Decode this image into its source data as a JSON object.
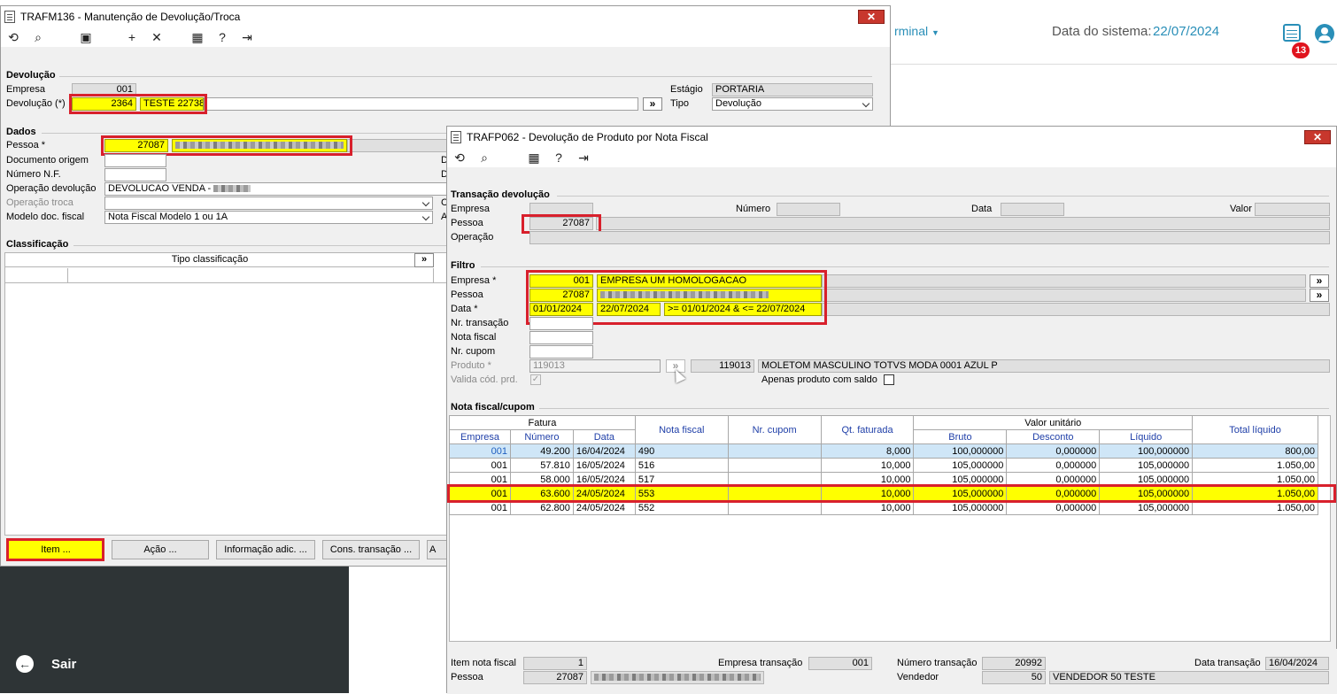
{
  "bg": {
    "terminal_label": "rminal",
    "system_date_label": "Data do sistema:",
    "system_date_value": "22/07/2024",
    "notification_count": "13",
    "exit_label": "Sair"
  },
  "win1": {
    "title": "TRAFM136 - Manutenção de Devolução/Troca",
    "devolucao": {
      "group_label": "Devolução",
      "empresa_label": "Empresa",
      "empresa_value": "001",
      "devolucao_label": "Devolução (*)",
      "devolucao_number": "2364",
      "devolucao_desc": "TESTE 22738",
      "estagio_label": "Estágio",
      "estagio_value": "PORTARIA",
      "tipo_label": "Tipo",
      "tipo_value": "Devolução"
    },
    "dados": {
      "group_label": "Dados",
      "pessoa_label": "Pessoa *",
      "pessoa_value": "27087",
      "doc_origem_label": "Documento origem",
      "numero_nf_label": "Número N.F.",
      "operacao_dev_label": "Operação devolução",
      "operacao_dev_value": "DEVOLUCAO VENDA -",
      "operacao_troca_label": "Operação troca",
      "modelo_label": "Modelo doc. fiscal",
      "modelo_value": "Nota Fiscal Modelo 1 ou 1A",
      "right_letters": [
        "D",
        "D",
        "C",
        "A"
      ]
    },
    "classificacao": {
      "group_label": "Classificação",
      "col_tipo": "Tipo classificação"
    },
    "buttons": {
      "item": "Item ...",
      "acao": "Ação ...",
      "info": "Informação adic. ...",
      "cons": "Cons. transação ...",
      "more": "A"
    }
  },
  "win2": {
    "title": "TRAFP062 - Devolução de Produto por Nota Fiscal",
    "transacao": {
      "group_label": "Transação devolução",
      "empresa_label": "Empresa",
      "numero_label": "Número",
      "data_label": "Data",
      "valor_label": "Valor",
      "pessoa_label": "Pessoa",
      "pessoa_value": "27087",
      "operacao_label": "Operação"
    },
    "filtro": {
      "group_label": "Filtro",
      "empresa_label": "Empresa *",
      "empresa_code": "001",
      "empresa_name": "EMPRESA UM HOMOLOGACAO",
      "pessoa_label": "Pessoa",
      "pessoa_code": "27087",
      "data_label": "Data *",
      "data_from": "01/01/2024",
      "data_to": "22/07/2024",
      "data_expr": ">= 01/01/2024 & <= 22/07/2024",
      "nr_transacao_label": "Nr. transação",
      "nota_fiscal_label": "Nota fiscal",
      "nr_cupom_label": "Nr. cupom",
      "produto_label": "Produto *",
      "produto_code": "119013",
      "produto_code2": "119013",
      "produto_desc": "MOLETOM MASCULINO TOTVS MODA 0001 AZUL P",
      "valida_label": "Valida cód. prd.",
      "apenas_label": "Apenas produto com saldo"
    },
    "nota": {
      "group_label": "Nota fiscal/cupom",
      "h_fatura": "Fatura",
      "h_empresa": "Empresa",
      "h_numero": "Número",
      "h_data": "Data",
      "h_nota_fiscal": "Nota fiscal",
      "h_nr_cupom": "Nr. cupom",
      "h_qt_faturada": "Qt. faturada",
      "h_valor_unitario": "Valor unitário",
      "h_bruto": "Bruto",
      "h_desconto": "Desconto",
      "h_liquido": "Líquido",
      "h_total_liquido": "Total líquido",
      "rows": [
        {
          "empresa": "001",
          "numero": "49.200",
          "data": "16/04/2024",
          "nf": "490",
          "cupom": "",
          "qt": "8,000",
          "bruto": "100,000000",
          "desconto": "0,000000",
          "liquido": "100,000000",
          "total": "800,00"
        },
        {
          "empresa": "001",
          "numero": "57.810",
          "data": "16/05/2024",
          "nf": "516",
          "cupom": "",
          "qt": "10,000",
          "bruto": "105,000000",
          "desconto": "0,000000",
          "liquido": "105,000000",
          "total": "1.050,00"
        },
        {
          "empresa": "001",
          "numero": "58.000",
          "data": "16/05/2024",
          "nf": "517",
          "cupom": "",
          "qt": "10,000",
          "bruto": "105,000000",
          "desconto": "0,000000",
          "liquido": "105,000000",
          "total": "1.050,00"
        },
        {
          "empresa": "001",
          "numero": "63.600",
          "data": "24/05/2024",
          "nf": "553",
          "cupom": "",
          "qt": "10,000",
          "bruto": "105,000000",
          "desconto": "0,000000",
          "liquido": "105,000000",
          "total": "1.050,00"
        },
        {
          "empresa": "001",
          "numero": "62.800",
          "data": "24/05/2024",
          "nf": "552",
          "cupom": "",
          "qt": "10,000",
          "bruto": "105,000000",
          "desconto": "0,000000",
          "liquido": "105,000000",
          "total": "1.050,00"
        }
      ]
    },
    "footer": {
      "item_nf_label": "Item nota fiscal",
      "item_nf_value": "1",
      "empresa_trans_label": "Empresa transação",
      "empresa_trans_value": "001",
      "numero_trans_label": "Número transação",
      "numero_trans_value": "20992",
      "data_trans_label": "Data transação",
      "data_trans_value": "16/04/2024",
      "pessoa_label": "Pessoa",
      "pessoa_value": "27087",
      "vendedor_label": "Vendedor",
      "vendedor_code": "50",
      "vendedor_name": "VENDEDOR 50 TESTE"
    }
  }
}
